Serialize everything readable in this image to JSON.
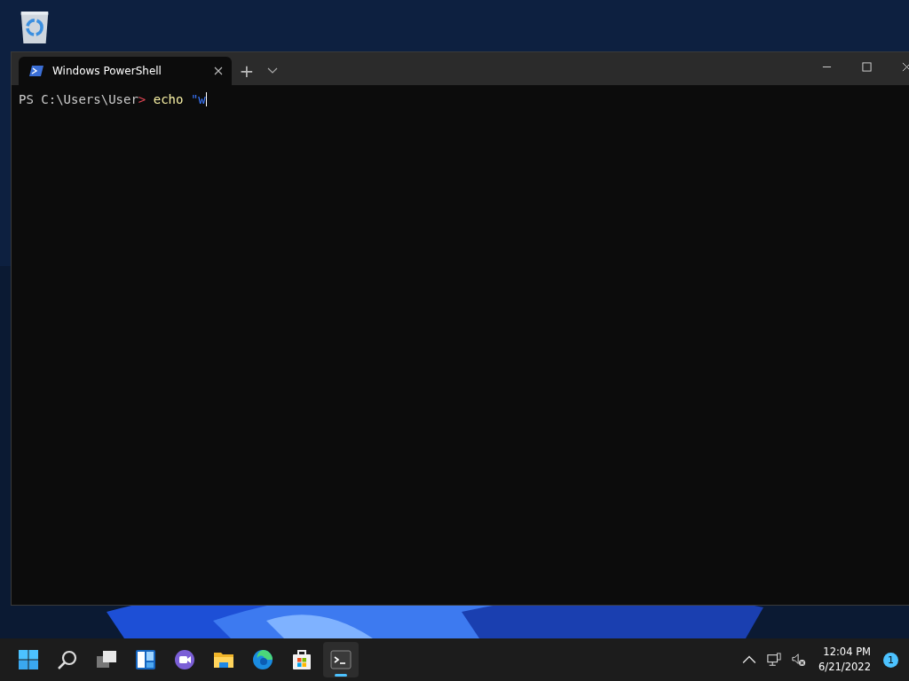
{
  "window": {
    "tabs": [
      {
        "title": "Windows PowerShell",
        "selected": true
      }
    ],
    "new_tab": "+"
  },
  "terminal": {
    "lines": [
      {
        "segments": [
          {
            "text": "PS C:\\Users\\User",
            "kind": "prompt"
          },
          {
            "text": ">",
            "kind": "operator"
          },
          {
            "text": " echo",
            "kind": "command"
          },
          {
            "text": " \"w",
            "kind": "string"
          }
        ],
        "cursor": true
      }
    ]
  },
  "taskbar": {
    "apps": [
      {
        "kind": "start",
        "active": false
      },
      {
        "kind": "search",
        "active": false
      },
      {
        "kind": "taskview",
        "active": false
      },
      {
        "kind": "widgets",
        "active": false
      },
      {
        "kind": "chat",
        "active": false
      },
      {
        "kind": "explorer",
        "active": false
      },
      {
        "kind": "edge",
        "active": false
      },
      {
        "kind": "store",
        "active": false
      },
      {
        "kind": "terminal",
        "active": true
      }
    ],
    "clock": {
      "time": "12:04 PM",
      "date": "6/21/2022"
    },
    "notifications": "1"
  }
}
